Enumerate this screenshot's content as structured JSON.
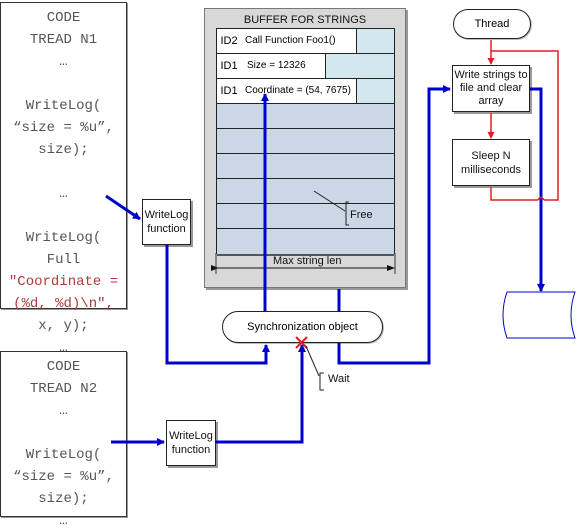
{
  "thread1": {
    "title_lines": [
      "CODE",
      "TREAD N1"
    ],
    "lines": [
      {
        "text": "…",
        "red": false
      },
      {
        "text": "",
        "red": false
      },
      {
        "text": "WriteLog(",
        "red": false
      },
      {
        "text": "“size = %u”,",
        "red": false
      },
      {
        "text": "size);",
        "red": false
      },
      {
        "text": "",
        "red": false
      },
      {
        "text": "…",
        "red": false
      },
      {
        "text": "",
        "red": false
      },
      {
        "text": "WriteLog(",
        "red": false
      },
      {
        "text": "Full",
        "suffix": ",",
        "red": false
      },
      {
        "text": "\"Coordinate =",
        "red": true
      },
      {
        "text": "(%d, %d)\\n\",",
        "red": true
      },
      {
        "text": "x, y);",
        "red": false
      },
      {
        "text": "…",
        "red": false
      }
    ]
  },
  "thread2": {
    "title_lines": [
      "CODE",
      "TREAD N2"
    ],
    "lines": [
      {
        "text": "…",
        "red": false
      },
      {
        "text": "",
        "red": false
      },
      {
        "text": "WriteLog(",
        "red": false
      },
      {
        "text": "“size = %u”,",
        "red": false
      },
      {
        "text": "size);",
        "red": false
      },
      {
        "text": "…",
        "red": false
      }
    ]
  },
  "writelog_fn_1": {
    "line1": "WriteLog",
    "line2": "function"
  },
  "writelog_fn_2": {
    "line1": "WriteLog",
    "line2": "function"
  },
  "buffer": {
    "title": "BUFFER FOR STRINGS",
    "entries": [
      {
        "id": "ID2",
        "text": "Call Function Foo1()"
      },
      {
        "id": "ID1",
        "text": "Size = 12326"
      },
      {
        "id": "ID1",
        "text": "Coordinate = (54, 7675)"
      }
    ],
    "free_slots": 6,
    "free_label": "Free",
    "max_len_label": "Max string len"
  },
  "sync": {
    "label": "Synchronization object",
    "wait_label": "Wait"
  },
  "flow": {
    "start": "Thread",
    "write_step": [
      "Write strings to",
      "file and clear",
      "array"
    ],
    "sleep_step": [
      "Sleep N",
      "milliseconds"
    ],
    "log_file": "Log File"
  },
  "colors": {
    "data_flow": "#0000cc",
    "control_flow": "#e02020",
    "used_slot": "#d2e8ee",
    "free_slot": "#c9d7e6"
  }
}
